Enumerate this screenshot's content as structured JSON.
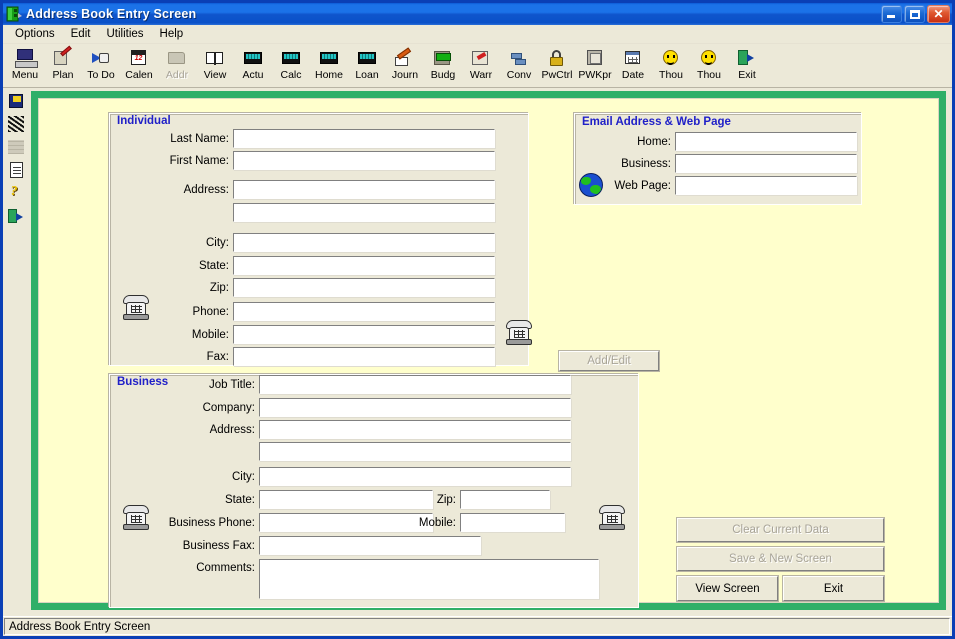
{
  "window": {
    "title": "Address Book Entry Screen",
    "icon": "address-book-icon",
    "minimize_label": "Minimize",
    "restore_label": "Restore",
    "close_label": "Close"
  },
  "menubar": {
    "items": [
      {
        "label": "Options"
      },
      {
        "label": "Edit"
      },
      {
        "label": "Utilities"
      },
      {
        "label": "Help"
      }
    ]
  },
  "toolbar": {
    "buttons": [
      {
        "label": "Menu",
        "icon": "monitor-icon",
        "disabled": false
      },
      {
        "label": "Plan",
        "icon": "planner-icon",
        "disabled": false
      },
      {
        "label": "To Do",
        "icon": "todo-icon",
        "disabled": false
      },
      {
        "label": "Calen",
        "icon": "calendar-icon",
        "disabled": false
      },
      {
        "label": "Addr",
        "icon": "address-book-icon",
        "disabled": true
      },
      {
        "label": "View",
        "icon": "open-book-icon",
        "disabled": false
      },
      {
        "label": "Actu",
        "icon": "calculator-icon",
        "disabled": false
      },
      {
        "label": "Calc",
        "icon": "calculator-icon",
        "disabled": false
      },
      {
        "label": "Home",
        "icon": "calculator-icon",
        "disabled": false
      },
      {
        "label": "Loan",
        "icon": "calculator-icon",
        "disabled": false
      },
      {
        "label": "Journ",
        "icon": "journal-icon",
        "disabled": false
      },
      {
        "label": "Budg",
        "icon": "budget-icon",
        "disabled": false
      },
      {
        "label": "Warr",
        "icon": "warranty-icon",
        "disabled": false
      },
      {
        "label": "Conv",
        "icon": "converter-icon",
        "disabled": false
      },
      {
        "label": "PwCtrl",
        "icon": "padlock-icon",
        "disabled": false
      },
      {
        "label": "PWKpr",
        "icon": "safe-icon",
        "disabled": false
      },
      {
        "label": "Date",
        "icon": "date-icon",
        "disabled": false
      },
      {
        "label": "Thou",
        "icon": "smiley-icon",
        "disabled": false
      },
      {
        "label": "Thou",
        "icon": "smiley-icon",
        "disabled": false
      },
      {
        "label": "Exit",
        "icon": "exit-door-icon",
        "disabled": false
      }
    ]
  },
  "sidebar": {
    "buttons": [
      {
        "name": "save",
        "icon": "floppy-save-icon",
        "disabled": false
      },
      {
        "name": "scribble",
        "icon": "scribble-icon",
        "disabled": false
      },
      {
        "name": "records",
        "icon": "records-icon",
        "disabled": true
      },
      {
        "name": "notes",
        "icon": "notepad-icon",
        "disabled": false
      },
      {
        "name": "help",
        "icon": "question-key-icon",
        "disabled": false
      },
      {
        "name": "exit",
        "icon": "exit-door-icon",
        "disabled": false
      }
    ]
  },
  "form": {
    "individual": {
      "legend": "Individual",
      "fields": [
        {
          "label": "Last Name:",
          "value": ""
        },
        {
          "label": "First Name:",
          "value": ""
        },
        {
          "label": "Address:",
          "value": ""
        },
        {
          "label": "",
          "value": ""
        },
        {
          "label": "City:",
          "value": ""
        },
        {
          "label": "State:",
          "value": ""
        },
        {
          "label": "Zip:",
          "value": ""
        },
        {
          "label": "Phone:",
          "value": ""
        },
        {
          "label": "Mobile:",
          "value": ""
        },
        {
          "label": "Fax:",
          "value": ""
        }
      ]
    },
    "email": {
      "legend": "Email Address & Web Page",
      "fields": [
        {
          "label": "Home:",
          "value": ""
        },
        {
          "label": "Business:",
          "value": ""
        },
        {
          "label": "Web Page:",
          "value": ""
        }
      ]
    },
    "business": {
      "legend": "Business",
      "fields": [
        {
          "label": "Job Title:",
          "value": ""
        },
        {
          "label": "Company:",
          "value": ""
        },
        {
          "label": "Address:",
          "value": ""
        },
        {
          "label": "",
          "value": ""
        },
        {
          "label": "City:",
          "value": ""
        },
        {
          "label": "State:",
          "value": ""
        },
        {
          "label": "Zip:",
          "value": ""
        },
        {
          "label": "Business Phone:",
          "value": ""
        },
        {
          "label": "Mobile:",
          "value": ""
        },
        {
          "label": "Business Fax:",
          "value": ""
        },
        {
          "label": "Comments:",
          "value": ""
        }
      ]
    }
  },
  "actions": {
    "add_edit": {
      "label": "Add/Edit",
      "disabled": true
    },
    "clear": {
      "label": "Clear Current Data",
      "disabled": true,
      "accel": "C"
    },
    "save_new": {
      "label": "Save & New Screen",
      "disabled": true,
      "accel": "S"
    },
    "view": {
      "label": "View Screen",
      "disabled": false,
      "accel": "V"
    },
    "exit": {
      "label": "Exit",
      "disabled": false,
      "accel": "x"
    }
  },
  "statusbar": {
    "text": "Address Book Entry Screen"
  },
  "colors": {
    "titlebar_blue": "#1b72e8",
    "frame_green": "#2faf68",
    "pane_yellow": "#ffffcc",
    "group_gray": "#ece9d8",
    "legend_blue": "#2020c8",
    "close_red": "#c82f12"
  }
}
